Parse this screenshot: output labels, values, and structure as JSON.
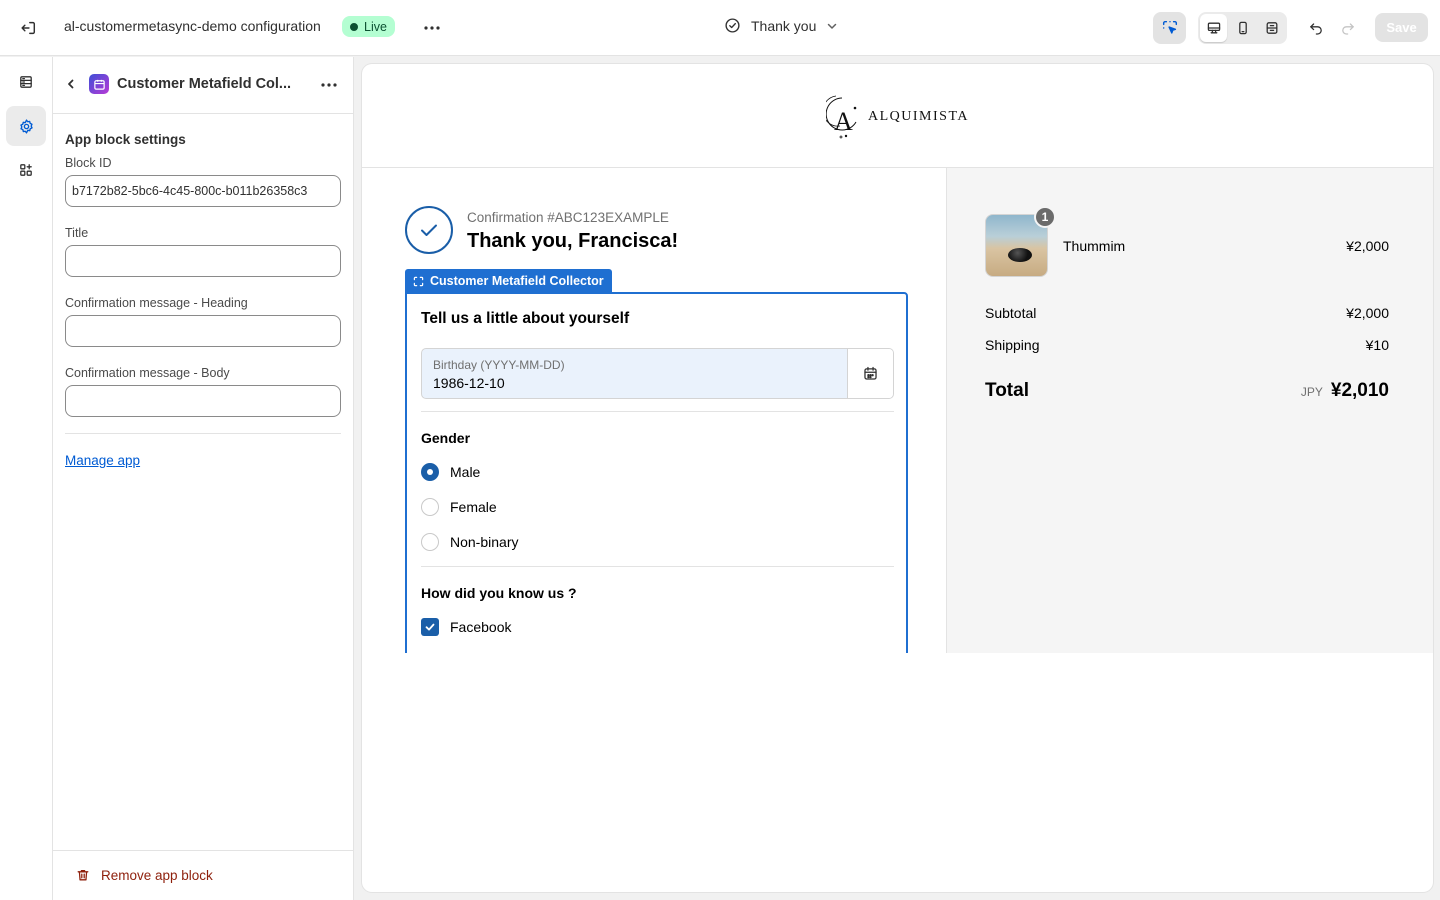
{
  "topbar": {
    "app_title": "al-customermetasync-demo configuration",
    "status_badge": "Live",
    "page_selector": "Thank you",
    "save_label": "Save"
  },
  "panel": {
    "title": "Customer Metafield Col...",
    "settings_heading": "App block settings",
    "fields": [
      {
        "label": "Block ID",
        "value": "b7172b82-5bc6-4c45-800c-b011b26358c3"
      },
      {
        "label": "Title",
        "value": ""
      },
      {
        "label": "Confirmation message - Heading",
        "value": ""
      },
      {
        "label": "Confirmation message - Body",
        "value": ""
      }
    ],
    "manage_link": "Manage app",
    "remove_label": "Remove app block"
  },
  "preview": {
    "store_name": "ALQUIMISTA",
    "logo_letter": "A",
    "confirmation_number": "Confirmation #ABC123EXAMPLE",
    "thanks_heading": "Thank you, Francisca!",
    "block_tag": "Customer Metafield Collector",
    "block": {
      "heading": "Tell us a little about yourself",
      "birthday_label": "Birthday (YYYY-MM-DD)",
      "birthday_value": "1986-12-10",
      "gender_label": "Gender",
      "gender_options": [
        "Male",
        "Female",
        "Non-binary"
      ],
      "gender_selected": "Male",
      "source_label": "How did you know us ?",
      "source_options": [
        "Facebook"
      ]
    },
    "summary": {
      "product_name": "Thummim",
      "product_qty": "1",
      "product_price": "¥2,000",
      "subtotal_label": "Subtotal",
      "subtotal_value": "¥2,000",
      "shipping_label": "Shipping",
      "shipping_value": "¥10",
      "total_label": "Total",
      "currency": "JPY",
      "total_value": "¥2,010"
    }
  },
  "colors": {
    "accent": "#1f6fd1",
    "checkbox": "#1a5ea8",
    "live_bg": "#b4fed2",
    "danger": "#8e1f0b",
    "link": "#005bd3"
  }
}
